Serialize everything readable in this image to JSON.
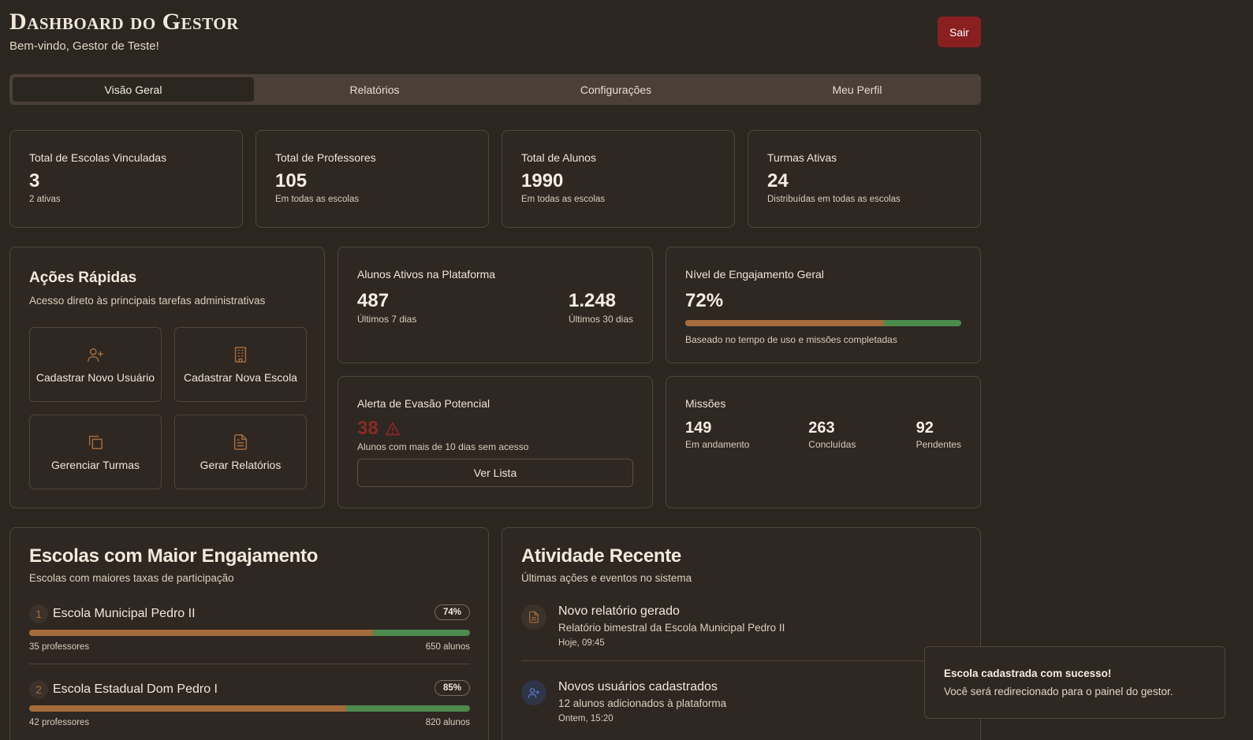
{
  "header": {
    "title": "Dashboard do Gestor",
    "welcome": "Bem-vindo, Gestor de Teste!",
    "logout_label": "Sair"
  },
  "tabs": [
    {
      "label": "Visão Geral",
      "active": true
    },
    {
      "label": "Relatórios",
      "active": false
    },
    {
      "label": "Configurações",
      "active": false
    },
    {
      "label": "Meu Perfil",
      "active": false
    }
  ],
  "stats": [
    {
      "label": "Total de Escolas Vinculadas",
      "value": "3",
      "sub": "2 ativas"
    },
    {
      "label": "Total de Professores",
      "value": "105",
      "sub": "Em todas as escolas"
    },
    {
      "label": "Total de Alunos",
      "value": "1990",
      "sub": "Em todas as escolas"
    },
    {
      "label": "Turmas Ativas",
      "value": "24",
      "sub": "Distribuídas em todas as escolas"
    }
  ],
  "quick_actions": {
    "title": "Ações Rápidas",
    "subtitle": "Acesso direto às principais tarefas administrativas",
    "items": [
      {
        "label": "Cadastrar Novo Usuário",
        "icon": "user-plus-icon"
      },
      {
        "label": "Cadastrar Nova Escola",
        "icon": "building-icon"
      },
      {
        "label": "Gerenciar Turmas",
        "icon": "copy-icon"
      },
      {
        "label": "Gerar Relatórios",
        "icon": "file-text-icon"
      }
    ]
  },
  "active_students": {
    "title": "Alunos Ativos na Plataforma",
    "value_7": "487",
    "label_7": "Últimos 7 dias",
    "value_30": "1.248",
    "label_30": "Últimos 30 dias"
  },
  "engagement": {
    "title": "Nível de Engajamento Geral",
    "value": "72%",
    "fraction": 0.72,
    "note": "Baseado no tempo de uso e missões completadas"
  },
  "dropout": {
    "title": "Alerta de Evasão Potencial",
    "value": "38",
    "note": "Alunos com mais de 10 dias sem acesso",
    "button": "Ver Lista",
    "color": "#8a2a26"
  },
  "missions": {
    "title": "Missões",
    "items": [
      {
        "value": "149",
        "label": "Em andamento"
      },
      {
        "value": "263",
        "label": "Concluídas"
      },
      {
        "value": "92",
        "label": "Pendentes"
      }
    ]
  },
  "top_schools": {
    "title": "Escolas com Maior Engajamento",
    "subtitle": "Escolas com maiores taxas de participação",
    "items": [
      {
        "rank": "1",
        "name": "Escola Municipal Pedro II",
        "percent": "74%",
        "fraction": 0.78,
        "teachers": "35 professores",
        "students": "650 alunos"
      },
      {
        "rank": "2",
        "name": "Escola Estadual Dom Pedro I",
        "percent": "85%",
        "fraction": 0.72,
        "teachers": "42 professores",
        "students": "820 alunos"
      }
    ]
  },
  "recent_activity": {
    "title": "Atividade Recente",
    "subtitle": "Últimas ações e eventos no sistema",
    "items": [
      {
        "title": "Novo relatório gerado",
        "desc": "Relatório bimestral da Escola Municipal Pedro II",
        "time": "Hoje, 09:45",
        "icon": "file-text-icon"
      },
      {
        "title": "Novos usuários cadastrados",
        "desc": "12 alunos adicionados à plataforma",
        "time": "Ontem, 15:20",
        "icon": "user-plus-icon"
      }
    ]
  },
  "toast": {
    "title": "Escola cadastrada com sucesso!",
    "message": "Você será redirecionado para o painel do gestor."
  },
  "colors": {
    "background": "#2c2621",
    "accent_brown": "#a46b3c",
    "accent_green": "#4c8a4d",
    "danger": "#8a1f21",
    "info_blue": "#5a7fd0"
  }
}
